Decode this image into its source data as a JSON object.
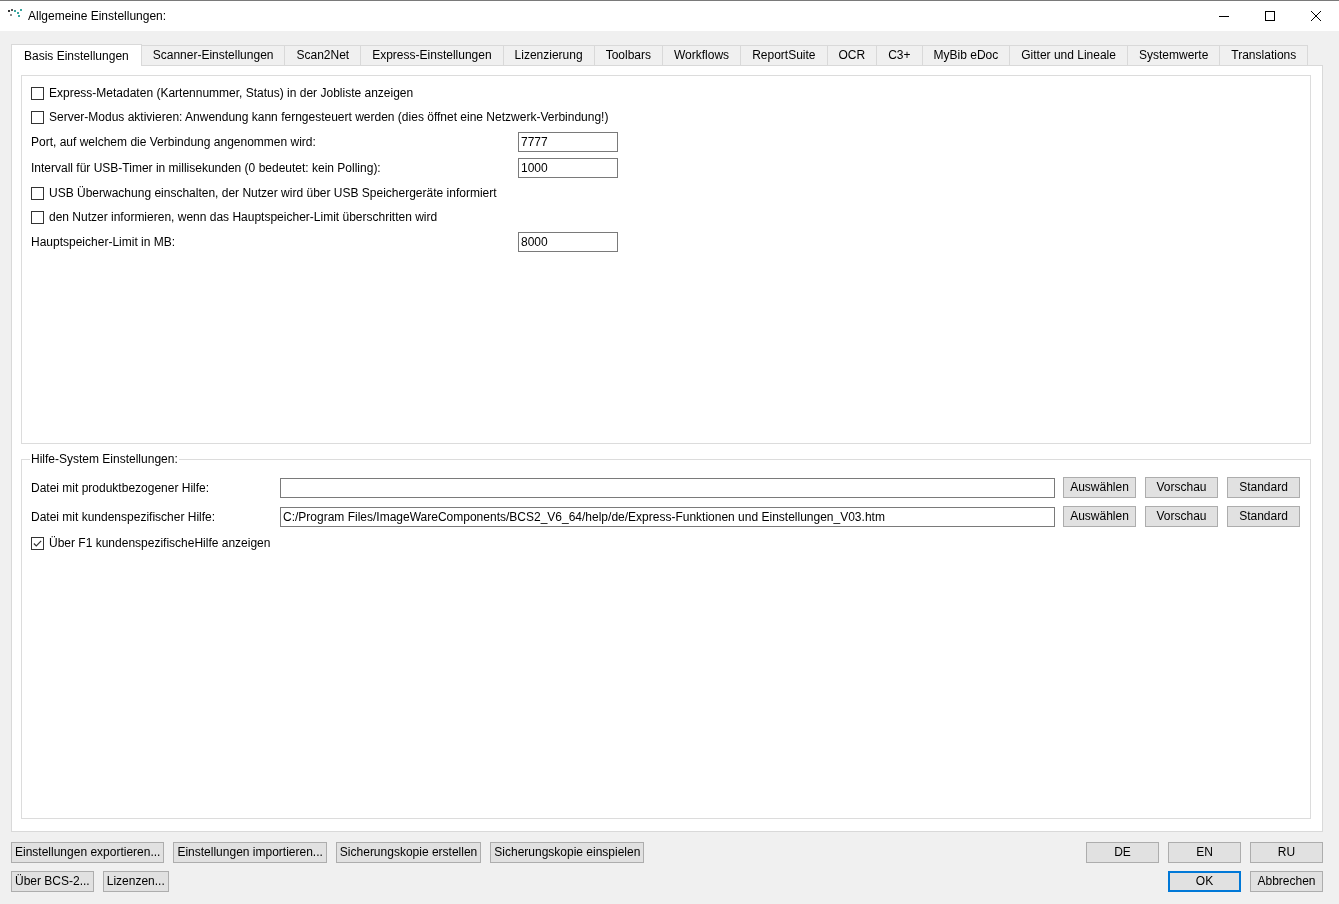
{
  "window": {
    "title": "Allgemeine Einstellungen:"
  },
  "tabs": [
    {
      "label": "Basis Einstellungen",
      "selected": true
    },
    {
      "label": "Scanner-Einstellungen",
      "selected": false
    },
    {
      "label": "Scan2Net",
      "selected": false
    },
    {
      "label": "Express-Einstellungen",
      "selected": false
    },
    {
      "label": "Lizenzierung",
      "selected": false
    },
    {
      "label": "Toolbars",
      "selected": false
    },
    {
      "label": "Workflows",
      "selected": false
    },
    {
      "label": "ReportSuite",
      "selected": false
    },
    {
      "label": "OCR",
      "selected": false
    },
    {
      "label": "C3+",
      "selected": false
    },
    {
      "label": "MyBib eDoc",
      "selected": false
    },
    {
      "label": "Gitter und Lineale",
      "selected": false
    },
    {
      "label": "Systemwerte",
      "selected": false
    },
    {
      "label": "Translations",
      "selected": false
    }
  ],
  "general_settings": {
    "rows": [
      {
        "kind": "checkbox",
        "label": "Express-Metadaten (Kartennummer, Status) in der Jobliste anzeigen",
        "checked": false
      },
      {
        "kind": "checkbox",
        "label": "Server-Modus aktivieren: Anwendung kann ferngesteuert werden (dies öffnet eine Netzwerk-Verbindung!)",
        "checked": false
      },
      {
        "kind": "field",
        "label": "Port, auf welchem die Verbindung angenommen wird:",
        "value": "7777"
      },
      {
        "kind": "field",
        "label": "Intervall für USB-Timer in millisekunden (0 bedeutet: kein Polling):",
        "value": "1000"
      },
      {
        "kind": "checkbox",
        "label": "USB Überwachung einschalten, der Nutzer wird über USB Speichergeräte informiert",
        "checked": false
      },
      {
        "kind": "checkbox",
        "label": "den Nutzer informieren, wenn das Hauptspeicher-Limit überschritten wird",
        "checked": false
      },
      {
        "kind": "field",
        "label": "Hauptspeicher-Limit in MB:",
        "value": "8000"
      }
    ]
  },
  "help_settings": {
    "title": "Hilfe-System Einstellungen:",
    "files": [
      {
        "label": "Datei mit produktbezogener Hilfe:",
        "buttons": [
          "Auswählen",
          "Vorschau",
          "Standard"
        ]
      },
      {
        "label": "Datei mit kundenspezifischer Hilfe:",
        "value": "C:/Program Files/ImageWareComponents/BCS2_V6_64/help/de/Express-Funktionen und Einstellungen_V03.htm",
        "buttons": [
          "Auswählen",
          "Vorschau",
          "Standard"
        ]
      }
    ],
    "options": [
      {
        "label": "Über F1 kundenspezifischeHilfe anzeigen",
        "checked": true
      }
    ]
  },
  "footer": {
    "actions": [
      [
        "Einstellungen exportieren...",
        "Einstellungen importieren...",
        "Sicherungskopie erstellen",
        "Sicherungskopie einspielen"
      ],
      [
        "Über BCS-2...",
        "Lizenzen..."
      ]
    ],
    "languages": [
      "DE",
      "EN",
      "RU"
    ],
    "dialog_buttons": [
      {
        "label": "OK",
        "focused": true
      },
      {
        "label": "Abbrechen",
        "focused": false
      }
    ]
  }
}
